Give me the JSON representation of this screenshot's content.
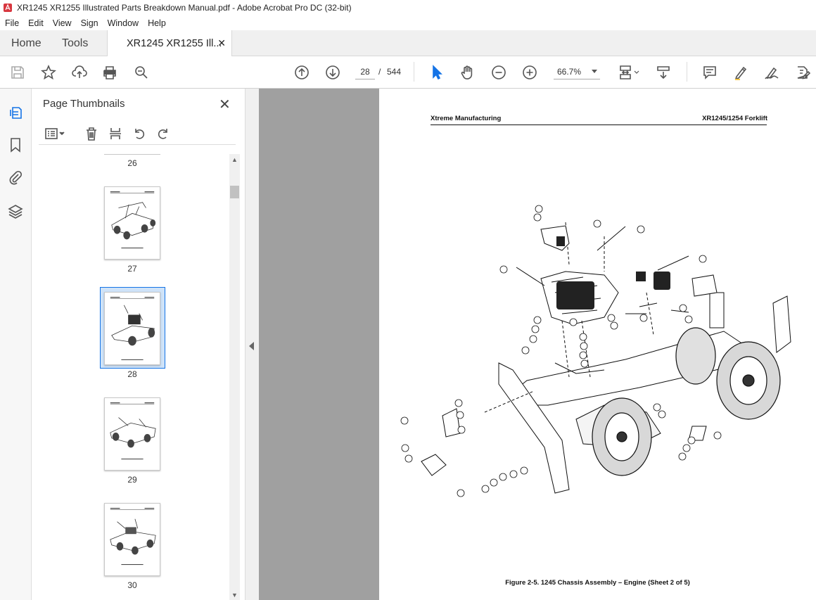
{
  "window": {
    "title": "XR1245 XR1255 Illustrated Parts  Breakdown Manual.pdf - Adobe Acrobat Pro DC (32-bit)"
  },
  "menu": [
    "File",
    "Edit",
    "View",
    "Sign",
    "Window",
    "Help"
  ],
  "tabs": {
    "home": "Home",
    "tools": "Tools",
    "document": "XR1245 XR1255 Ill..."
  },
  "toolbar": {
    "current_page": "28",
    "page_separator": "/",
    "total_pages": "544",
    "zoom": "66.7%"
  },
  "panel": {
    "title": "Page Thumbnails",
    "thumbnails": [
      {
        "label": "26"
      },
      {
        "label": "27"
      },
      {
        "label": "28",
        "selected": true
      },
      {
        "label": "29"
      },
      {
        "label": "30"
      }
    ]
  },
  "document": {
    "header_left": "Xtreme Manufacturing",
    "header_right": "XR1245/1254 Forklift",
    "caption": "Figure 2-5.  1245 Chassis Assembly – Engine  (Sheet 2 of 5)"
  },
  "colors": {
    "selection": "#1473e6",
    "acrobat_red": "#d7373f",
    "viewer_bg": "#a0a0a0"
  }
}
